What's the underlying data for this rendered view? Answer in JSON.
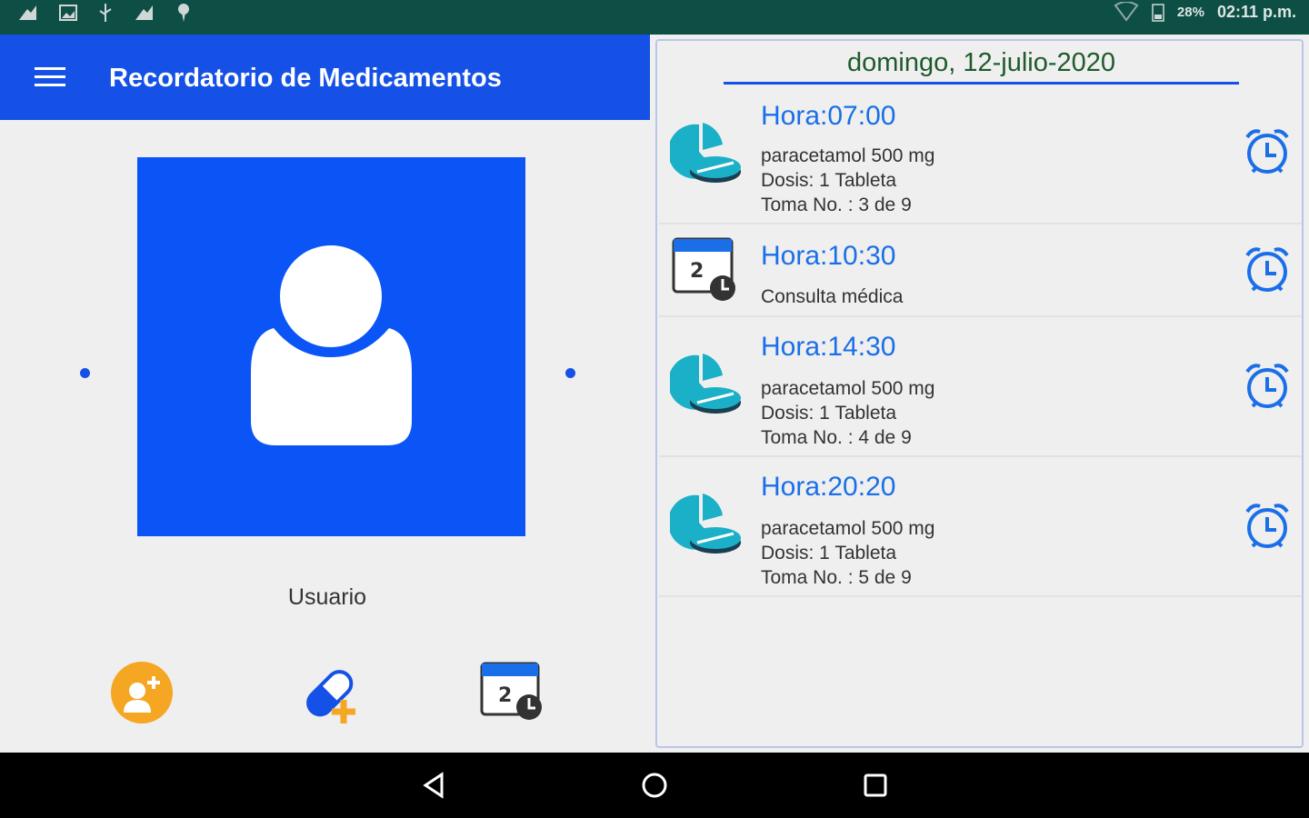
{
  "status_bar": {
    "battery": "28%",
    "time": "02:11 p.m.",
    "left_icons": [
      "notification-icon",
      "image-icon",
      "usb-icon",
      "notification-icon",
      "location-icon"
    ]
  },
  "app_bar": {
    "title": "Recordatorio de Medicamentos"
  },
  "profile": {
    "name": "Usuario",
    "actions": [
      "add-user-icon",
      "add-medication-icon",
      "calendar-appointment-icon"
    ]
  },
  "schedule": {
    "date": "domingo, 12-julio-2020",
    "entries": [
      {
        "type": "medication",
        "icon": "pill-icon",
        "hour": "Hora:07:00",
        "medicine": "paracetamol 500 mg",
        "dose": "Dosis: 1 Tableta",
        "take": "Toma No. : 3 de 9"
      },
      {
        "type": "appointment",
        "icon": "calendar-icon",
        "hour": "Hora:10:30",
        "description": "Consulta médica"
      },
      {
        "type": "medication",
        "icon": "pill-icon",
        "hour": "Hora:14:30",
        "medicine": "paracetamol 500 mg",
        "dose": "Dosis: 1 Tableta",
        "take": "Toma No. : 4 de 9"
      },
      {
        "type": "medication",
        "icon": "pill-icon",
        "hour": "Hora:20:20",
        "medicine": "paracetamol 500 mg",
        "dose": "Dosis: 1 Tableta",
        "take": "Toma No. : 5 de 9"
      }
    ]
  },
  "colors": {
    "status_bar": "#0d4f45",
    "primary": "#1551e6",
    "avatar_bg": "#0b55f7",
    "hour_text": "#1a6fe8",
    "date_text": "#1e5b2c",
    "pill": "#1ab0c8",
    "orange": "#f5a623"
  }
}
